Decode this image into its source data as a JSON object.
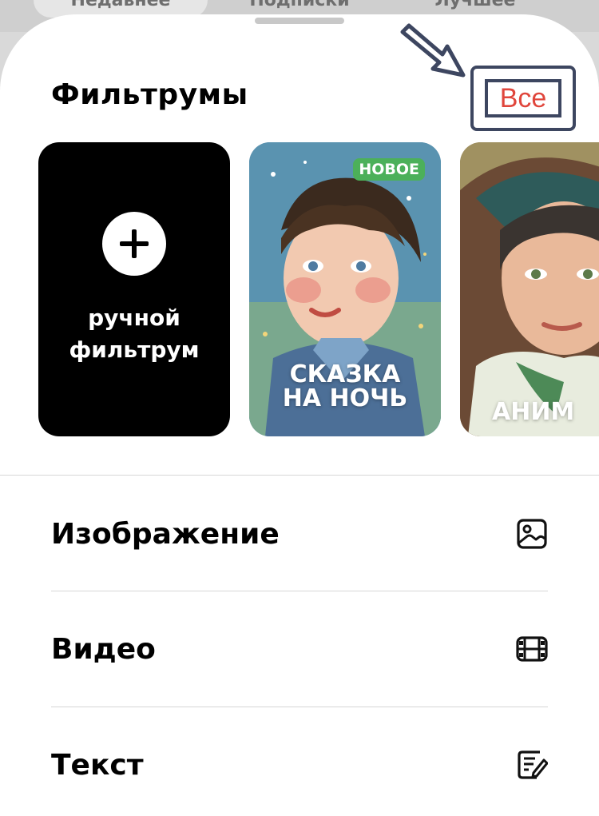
{
  "background_tabs": [
    "Недавнее",
    "Подписки",
    "Лучшее"
  ],
  "header": {
    "title": "Фильтрумы",
    "all_button_label": "Все"
  },
  "cards": [
    {
      "label_line1": "ручной",
      "label_line2": "фильтрум",
      "icon": "plus-icon"
    },
    {
      "badge": "НОВОЕ",
      "caption_line1": "СКАЗКА",
      "caption_line2": "НА НОЧЬ"
    },
    {
      "caption_line1": "АНИМ"
    }
  ],
  "list": [
    {
      "label": "Изображение",
      "icon": "image-icon"
    },
    {
      "label": "Видео",
      "icon": "film-icon"
    },
    {
      "label": "Текст",
      "icon": "edit-text-icon"
    }
  ],
  "colors": {
    "accent": "#e0463c",
    "annotation": "#3d4660",
    "badge_green": "#4cb05a"
  }
}
